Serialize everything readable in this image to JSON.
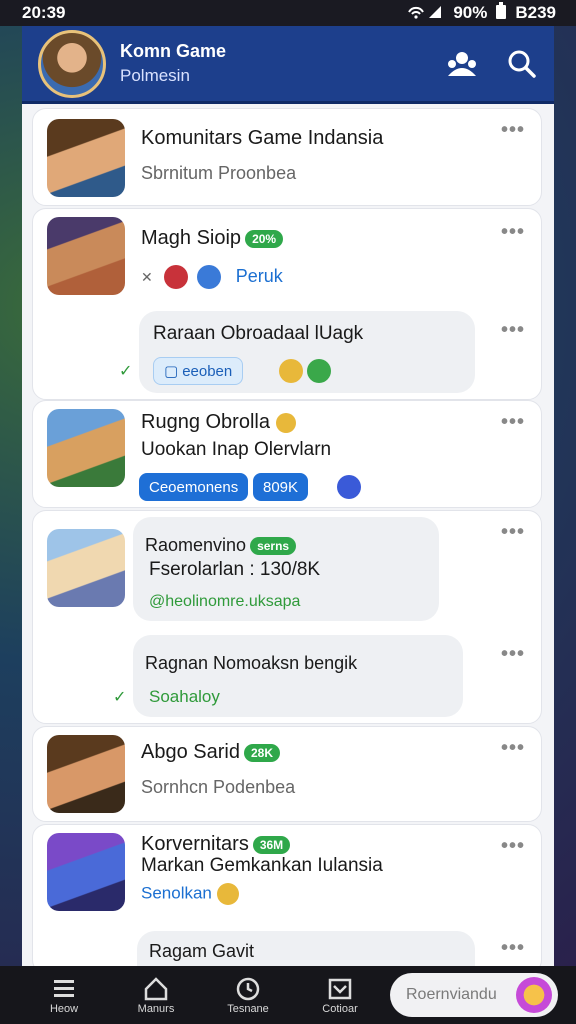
{
  "status": {
    "time": "20:39",
    "battery": "90%",
    "clock_right": "B239"
  },
  "header": {
    "title": "Komn Game",
    "subtitle": "Polmesin"
  },
  "items": [
    {
      "title": "Komunitars Game Indansia",
      "subtitle": "Sbrnitum Proonbea"
    },
    {
      "title": "Magh Sioip",
      "badge": "20%",
      "link": "Peruk"
    },
    {
      "title": "Raraan Obroadaal lUagk",
      "chip": "eeoben"
    },
    {
      "title": "Rugng Obrolla",
      "subtitle": "Uookan Inap Olervlarn",
      "chip1": "Ceoemonens",
      "chip2": "809K"
    },
    {
      "title": "Raomenvino",
      "badge": "serns",
      "subtitle": "Fserolarlan : 130/8K",
      "link": "@heolinomre.uksapa"
    },
    {
      "title": "Ragnan Nomoaksn bengik",
      "link": "Soahaloy"
    },
    {
      "title": "Abgo Sarid",
      "badge": "28K",
      "subtitle": "Sornhcn Podenbea"
    },
    {
      "title": "Korvernitars",
      "badge": "36M",
      "subtitle": "Markan Gemkankan Iulansia",
      "link": "Senolkan"
    },
    {
      "title": "Ragam Gavit"
    }
  ],
  "nav": {
    "items": [
      "Heow",
      "Manurs",
      "Tesnane",
      "Cotioar"
    ],
    "input_placeholder": "Roernviandu"
  }
}
